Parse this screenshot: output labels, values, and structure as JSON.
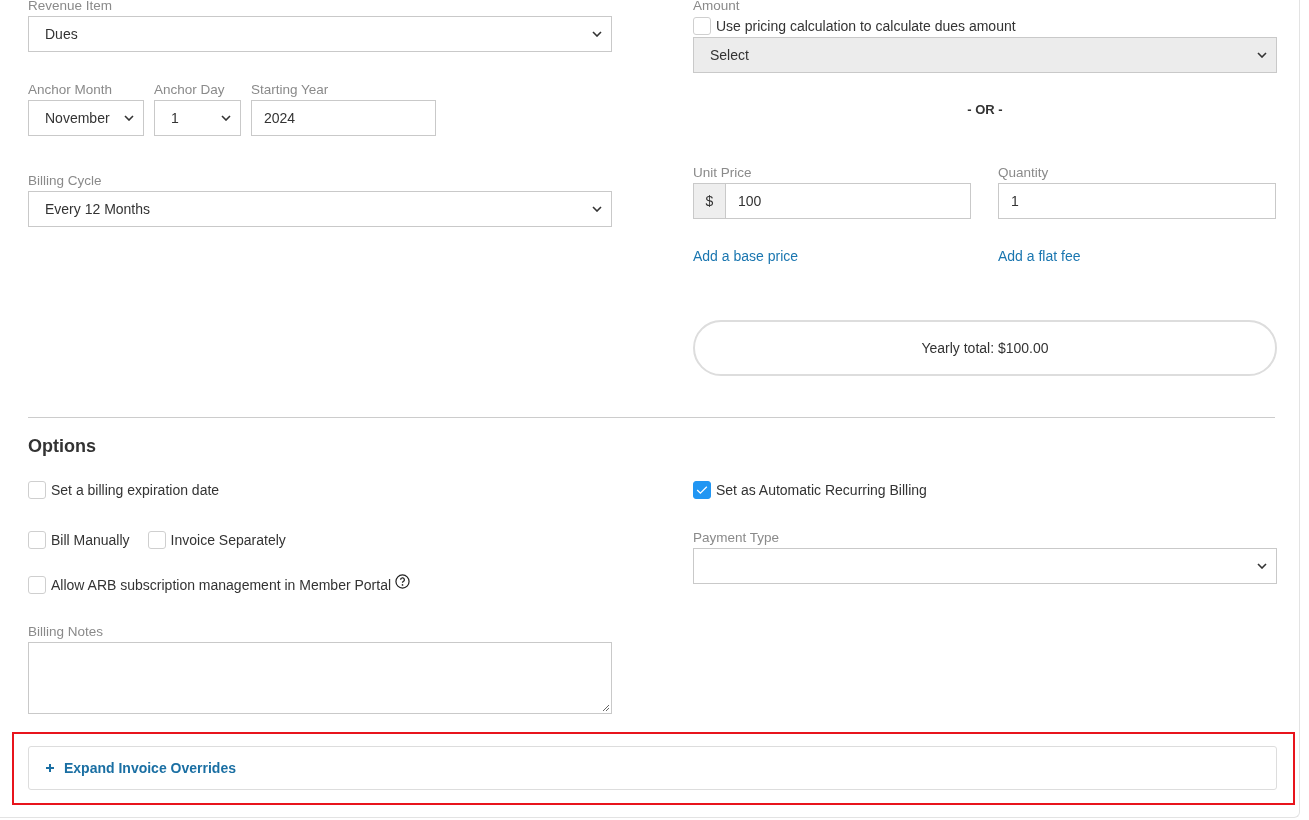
{
  "billing": {
    "revenue_item": {
      "label": "Revenue Item",
      "value": "Dues"
    },
    "anchor_month": {
      "label": "Anchor Month",
      "value": "November"
    },
    "anchor_day": {
      "label": "Anchor Day",
      "value": "1"
    },
    "starting_year": {
      "label": "Starting Year",
      "value": "2024"
    },
    "billing_cycle": {
      "label": "Billing Cycle",
      "value": "Every 12 Months"
    }
  },
  "amount": {
    "label": "Amount",
    "pricing_checkbox": {
      "label": "Use pricing calculation to calculate dues amount",
      "checked": false
    },
    "pricing_select": {
      "value": "Select",
      "disabled": true
    },
    "separator": "- OR -",
    "unit_price": {
      "label": "Unit Price",
      "prefix": "$",
      "value": "100"
    },
    "quantity": {
      "label": "Quantity",
      "value": "1"
    },
    "links": [
      "Add a base price",
      "Add a flat fee"
    ],
    "total": "Yearly total: $100.00"
  },
  "options": {
    "heading": "Options",
    "rows": [
      [
        {
          "label": "Set a billing expiration date",
          "checked": false,
          "help": false
        }
      ],
      [
        {
          "label": "Bill Manually",
          "checked": false,
          "help": false
        },
        {
          "label": "Invoice Separately",
          "checked": false,
          "help": false
        }
      ],
      [
        {
          "label": "Allow ARB subscription management in Member Portal",
          "checked": false,
          "help": true
        }
      ]
    ],
    "arb": {
      "label": "Set as Automatic Recurring Billing",
      "checked": true
    },
    "payment_type": {
      "label": "Payment Type"
    },
    "billing_notes": {
      "label": "Billing Notes"
    }
  },
  "overrides": {
    "label": "Expand Invoice Overrides",
    "expanded": false
  }
}
